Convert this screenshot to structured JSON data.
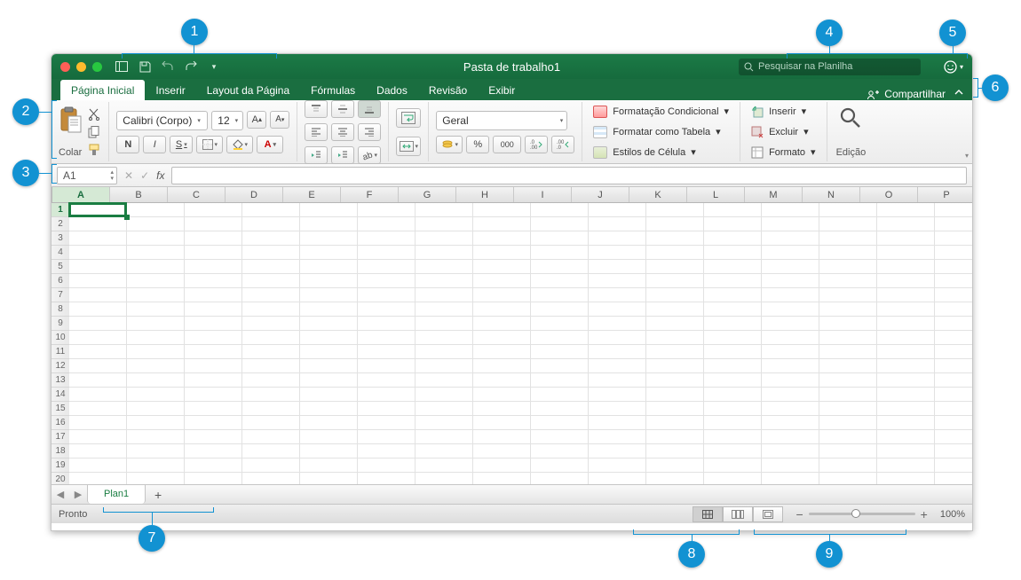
{
  "accent": "#1a7d42",
  "titlebar": {
    "title": "Pasta de trabalho1",
    "search_placeholder": "Pesquisar na Planilha"
  },
  "tabs": [
    "Página Inicial",
    "Inserir",
    "Layout da Página",
    "Fórmulas",
    "Dados",
    "Revisão",
    "Exibir"
  ],
  "active_tab": 0,
  "share_label": "Compartilhar",
  "ribbon": {
    "paste": "Colar",
    "font_name": "Calibri (Corpo)",
    "font_size": "12",
    "bold": "N",
    "italic": "I",
    "underline": "S",
    "number_format": "Geral",
    "cond_format": "Formatação Condicional",
    "format_table": "Formatar como Tabela",
    "cell_styles": "Estilos de Célula",
    "insert": "Inserir",
    "delete": "Excluir",
    "format": "Formato",
    "editing": "Edição",
    "thousands": "000"
  },
  "namebox": "A1",
  "columns": [
    "A",
    "B",
    "C",
    "D",
    "E",
    "F",
    "G",
    "H",
    "I",
    "J",
    "K",
    "L",
    "M",
    "N",
    "O",
    "P"
  ],
  "rows": [
    "1",
    "2",
    "3",
    "4",
    "5",
    "6",
    "7",
    "8",
    "9",
    "10",
    "11",
    "12",
    "13",
    "14",
    "15",
    "16",
    "17",
    "18",
    "19",
    "20"
  ],
  "active_cell": {
    "col": 0,
    "row": 0
  },
  "sheet_tab": "Plan1",
  "status": "Pronto",
  "zoom": "100%",
  "callouts": [
    "1",
    "2",
    "3",
    "4",
    "5",
    "6",
    "7",
    "8",
    "9"
  ]
}
